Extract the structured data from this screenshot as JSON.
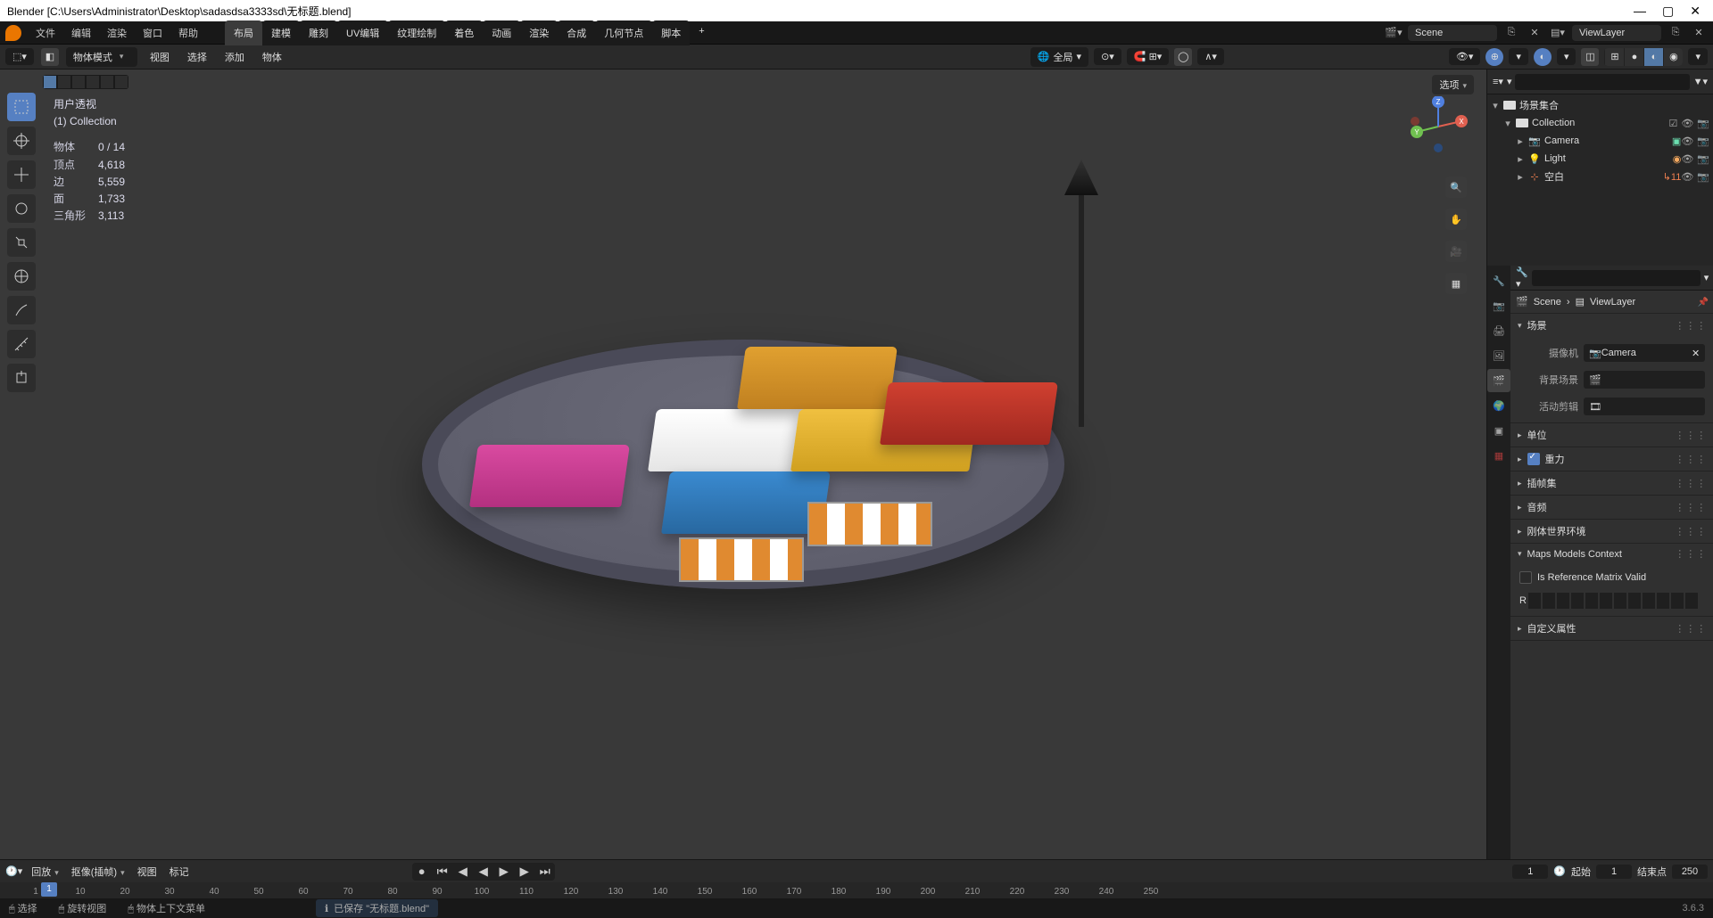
{
  "window": {
    "title": "Blender [C:\\Users\\Administrator\\Desktop\\sadasdsa3333sd\\无标题.blend]",
    "minimize": "—",
    "maximize": "▢",
    "close": "✕"
  },
  "top_menu": {
    "items": [
      "文件",
      "编辑",
      "渲染",
      "窗口",
      "帮助"
    ],
    "workspaces": [
      "布局",
      "建模",
      "雕刻",
      "UV编辑",
      "纹理绘制",
      "着色",
      "动画",
      "渲染",
      "合成",
      "几何节点",
      "脚本"
    ],
    "plus": "+",
    "scene_field": "Scene",
    "viewlayer_field": "ViewLayer"
  },
  "viewport_header": {
    "mode": "物体模式",
    "menus": [
      "视图",
      "选择",
      "添加",
      "物体"
    ],
    "pivot": "全局",
    "options_btn": "选项"
  },
  "stats": {
    "title": "用户透视",
    "collection": "(1) Collection",
    "rows": [
      {
        "label": "物体",
        "value": "0 / 14"
      },
      {
        "label": "顶点",
        "value": "4,618"
      },
      {
        "label": "边",
        "value": "5,559"
      },
      {
        "label": "面",
        "value": "1,733"
      },
      {
        "label": "三角形",
        "value": "3,113"
      }
    ]
  },
  "gizmo": {
    "x": "X",
    "y": "Y",
    "z": "Z"
  },
  "viewport_nav": {
    "zoom": "🔍",
    "pan": "✋",
    "camera": "🎥",
    "grid": "▦"
  },
  "outliner": {
    "root": "场景集合",
    "collection": "Collection",
    "items": [
      {
        "name": "Camera",
        "badge": "▣"
      },
      {
        "name": "Light",
        "badge": "◉"
      },
      {
        "name": "空白",
        "badge": "↳11"
      }
    ],
    "search_placeholder": ""
  },
  "properties": {
    "search_placeholder": "",
    "breadcrumb_scene": "Scene",
    "breadcrumb_viewlayer": "ViewLayer",
    "tabs": [
      "render",
      "output",
      "viewlayer",
      "scene",
      "world",
      "object",
      "modifier",
      "particle",
      "physics",
      "constraint",
      "data",
      "material",
      "texture"
    ],
    "panels": {
      "scene": {
        "title": "场景",
        "camera_label": "摄像机",
        "camera_value": "Camera",
        "bg_scene_label": "背景场景",
        "active_clip_label": "活动剪辑"
      },
      "units": {
        "title": "单位"
      },
      "gravity": {
        "title": "重力"
      },
      "keying_sets": {
        "title": "插帧集"
      },
      "audio": {
        "title": "音频"
      },
      "rigidbody": {
        "title": "刚体世界环境"
      },
      "maps": {
        "title": "Maps Models Context",
        "ref_label": "Is Reference Matrix Valid",
        "r_label": "R"
      },
      "custom": {
        "title": "自定义属性"
      }
    }
  },
  "timeline": {
    "playback": "回放",
    "keying": "抠像(插帧)",
    "menus": [
      "视图",
      "标记"
    ],
    "transport": {
      "autokey": "●",
      "first": "⏮",
      "prev": "◀",
      "play": "▶",
      "next": "▶",
      "last": "⏭"
    },
    "current": "1",
    "start_label": "起始",
    "start": "1",
    "end_label": "结束点",
    "end": "250",
    "ticks": [
      1,
      10,
      20,
      30,
      40,
      50,
      60,
      70,
      80,
      90,
      100,
      110,
      120,
      130,
      140,
      150,
      160,
      170,
      180,
      190,
      200,
      210,
      220,
      230,
      240,
      250
    ]
  },
  "status": {
    "items": [
      {
        "icon": "🖱",
        "text": "选择"
      },
      {
        "icon": "🖱",
        "text": "旋转视图"
      },
      {
        "icon": "🖱",
        "text": "物体上下文菜单"
      }
    ],
    "message": "已保存 \"无标题.blend\"",
    "version": "3.6.3"
  }
}
